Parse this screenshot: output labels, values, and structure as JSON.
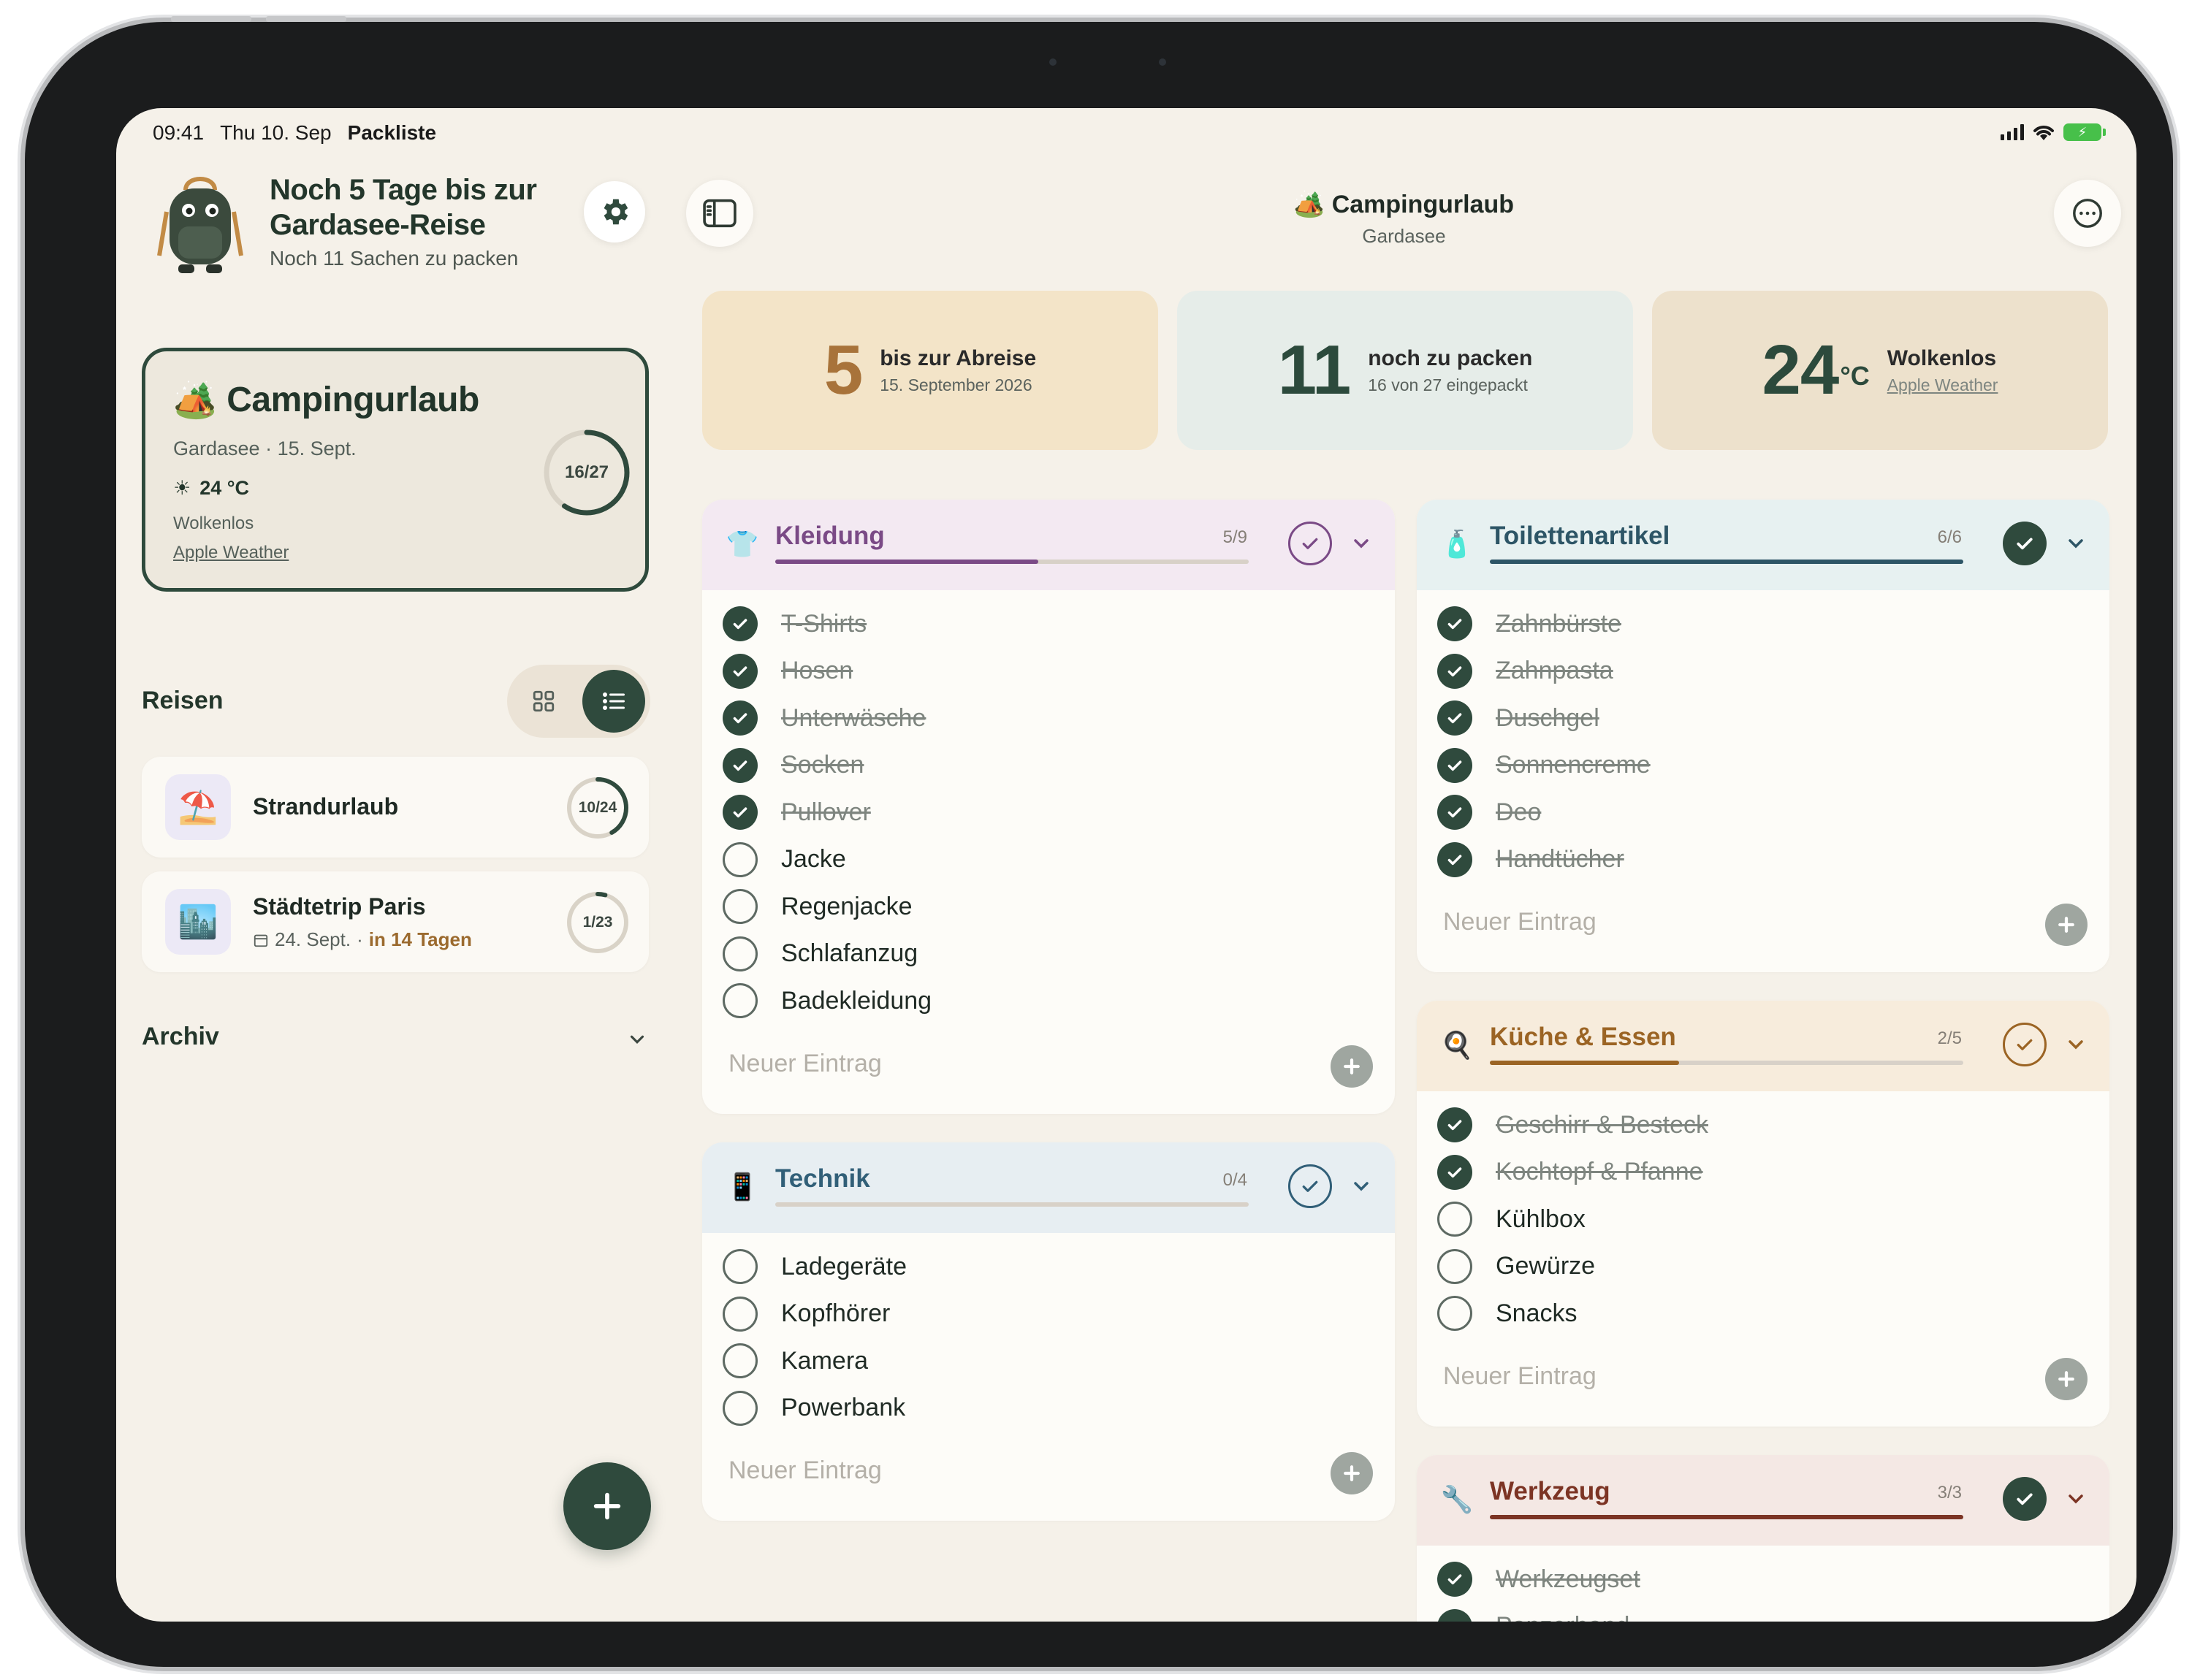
{
  "status_bar": {
    "time": "09:41",
    "date": "Thu 10. Sep",
    "app": "Packliste",
    "battery_color": "#47c04a"
  },
  "sidebar": {
    "headline": "Noch 5 Tage bis zur Gardasee-Reise",
    "subline": "Noch 11 Sachen zu packen",
    "settings_icon": "gear-icon",
    "featured_trip": {
      "title": "Campingurlaub",
      "meta": "Gardasee · 15. Sept.",
      "temperature": "24 °C",
      "condition": "Wolkenlos",
      "weather_link": "Apple Weather",
      "progress_label": "16/27",
      "progress": 0.593
    },
    "trips_heading": "Reisen",
    "trips": [
      {
        "name": "Strandurlaub",
        "progress_label": "10/24",
        "progress": 0.417,
        "icon": "beach-umbrella-icon"
      },
      {
        "name": "Städtetrip Paris",
        "date": "24. Sept.",
        "separator": "·",
        "soon": "in 14 Tagen",
        "progress_label": "1/23",
        "progress": 0.043,
        "icon": "city-icon"
      }
    ],
    "archive_heading": "Archiv"
  },
  "main": {
    "title": "Campingurlaub",
    "subtitle": "Gardasee",
    "stats": [
      {
        "value": "5",
        "label": "bis zur Abreise",
        "sub": "15. September 2026",
        "color": "#a8733a",
        "bg": "#f3e4c8"
      },
      {
        "value": "11",
        "label": "noch zu packen",
        "sub": "16 von 27 eingepackt",
        "color": "#2c4a3c",
        "bg": "#e6ede9"
      },
      {
        "value": "24",
        "unit": "°C",
        "label": "Wolkenlos",
        "sub": "Apple Weather",
        "color": "#2c4a3c",
        "bg": "#ede1cc"
      }
    ],
    "new_entry_placeholder": "Neuer Eintrag",
    "categories": {
      "kleidung": {
        "name": "Kleidung",
        "count": "5/9",
        "progress": 0.556,
        "color": "#7a4a86",
        "head_bg": "#f3e9f2",
        "items": [
          {
            "label": "T-Shirts",
            "done": true
          },
          {
            "label": "Hosen",
            "done": true
          },
          {
            "label": "Unterwäsche",
            "done": true
          },
          {
            "label": "Socken",
            "done": true
          },
          {
            "label": "Pullover",
            "done": true
          },
          {
            "label": "Jacke",
            "done": false
          },
          {
            "label": "Regenjacke",
            "done": false
          },
          {
            "label": "Schlafanzug",
            "done": false
          },
          {
            "label": "Badekleidung",
            "done": false
          }
        ]
      },
      "technik": {
        "name": "Technik",
        "count": "0/4",
        "progress": 0,
        "color": "#315f78",
        "head_bg": "#e7eef2",
        "items": [
          {
            "label": "Ladegeräte",
            "done": false
          },
          {
            "label": "Kopfhörer",
            "done": false
          },
          {
            "label": "Kamera",
            "done": false
          },
          {
            "label": "Powerbank",
            "done": false
          }
        ]
      },
      "toilettenartikel": {
        "name": "Toilettenartikel",
        "count": "6/6",
        "progress": 1,
        "color": "#2d5566",
        "head_bg": "#e7f1f1",
        "items": [
          {
            "label": "Zahnbürste",
            "done": true
          },
          {
            "label": "Zahnpasta",
            "done": true
          },
          {
            "label": "Duschgel",
            "done": true
          },
          {
            "label": "Sonnencreme",
            "done": true
          },
          {
            "label": "Deo",
            "done": true
          },
          {
            "label": "Handtücher",
            "done": true
          }
        ]
      },
      "kueche": {
        "name": "Küche & Essen",
        "count": "2/5",
        "progress": 0.4,
        "color": "#9b6424",
        "head_bg": "#f7ecdc",
        "items": [
          {
            "label": "Geschirr & Besteck",
            "done": true
          },
          {
            "label": "Kochtopf & Pfanne",
            "done": true
          },
          {
            "label": "Kühlbox",
            "done": false
          },
          {
            "label": "Gewürze",
            "done": false
          },
          {
            "label": "Snacks",
            "done": false
          }
        ]
      },
      "werkzeug": {
        "name": "Werkzeug",
        "count": "3/3",
        "progress": 1,
        "color": "#7c3424",
        "head_bg": "#f4e8e4",
        "items": [
          {
            "label": "Werkzeugset",
            "done": true
          },
          {
            "label": "Panzerband",
            "done": true
          }
        ]
      }
    }
  }
}
